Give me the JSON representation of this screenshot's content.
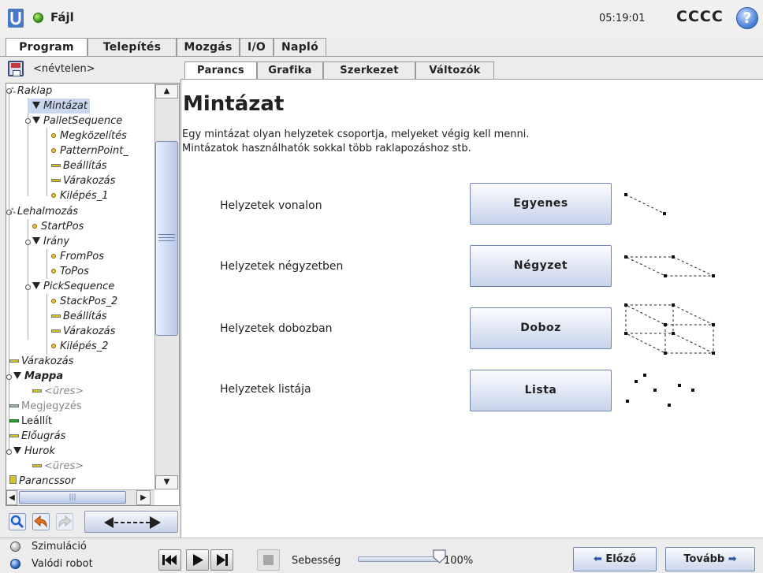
{
  "topbar": {
    "file_menu": "Fájl",
    "time": "05:19:01",
    "robot_name": "CCCC",
    "help_glyph": "?"
  },
  "main_tabs": [
    "Program",
    "Telepítés",
    "Mozgás",
    "I/O",
    "Napló"
  ],
  "program_name": "<névtelen>",
  "sub_tabs": [
    "Parancs",
    "Grafika",
    "Szerkezet",
    "Változók"
  ],
  "tree": [
    {
      "label": "Raklap"
    },
    {
      "label": "Mintázat"
    },
    {
      "label": "PalletSequence"
    },
    {
      "label": "Megközelítés"
    },
    {
      "label": "PatternPoint_"
    },
    {
      "label": "Beállítás"
    },
    {
      "label": "Várakozás"
    },
    {
      "label": "Kilépés_1"
    },
    {
      "label": "Lehalmozás"
    },
    {
      "label": "StartPos"
    },
    {
      "label": "Irány"
    },
    {
      "label": "FromPos"
    },
    {
      "label": "ToPos"
    },
    {
      "label": "PickSequence"
    },
    {
      "label": "StackPos_2"
    },
    {
      "label": "Beállítás"
    },
    {
      "label": "Várakozás"
    },
    {
      "label": "Kilépés_2"
    },
    {
      "label": "Várakozás"
    },
    {
      "label": "Mappa"
    },
    {
      "label": "<üres>"
    },
    {
      "label": "Megjegyzés"
    },
    {
      "label": "Leállít"
    },
    {
      "label": "Előugrás"
    },
    {
      "label": "Hurok"
    },
    {
      "label": "<üres>"
    },
    {
      "label": "Parancssor"
    }
  ],
  "content": {
    "title": "Mintázat",
    "desc_line1": "Egy mintázat olyan helyzetek csoportja, melyeket végig kell menni.",
    "desc_line2": "Mintázatok használhatók sokkal több raklapozáshoz stb.",
    "patterns": [
      {
        "label": "Helyzetek vonalon",
        "button": "Egyenes"
      },
      {
        "label": "Helyzetek négyzetben",
        "button": "Négyzet"
      },
      {
        "label": "Helyzetek dobozban",
        "button": "Doboz"
      },
      {
        "label": "Helyzetek listája",
        "button": "Lista"
      }
    ]
  },
  "footer": {
    "simulation": "Szimuláció",
    "real_robot": "Valódi robot",
    "speed_label": "Sebesség",
    "speed_value": "100%",
    "speed_fraction": 1.0,
    "prev": "Előző",
    "next": "Tovább"
  },
  "colors": {
    "accent": "#c6d3ea",
    "selection": "#c8d6ee",
    "status_green": "#3f9b17"
  }
}
